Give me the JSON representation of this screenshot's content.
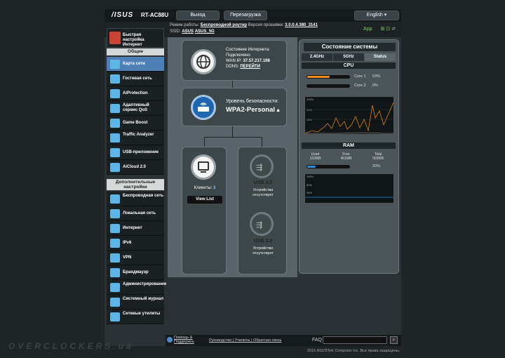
{
  "header": {
    "logo": "/ISUS",
    "model": "RT-AC88U",
    "logout": "Выход",
    "reboot": "Перезагрузка",
    "language": "English"
  },
  "info": {
    "mode_label": "Режим работы:",
    "mode_value": "Беспроводной роутер",
    "fw_label": "Версия прошивки:",
    "fw_value": "3.0.0.4.380_3141",
    "ssid_label": "SSID:",
    "ssid1": "ASUS",
    "ssid2": "ASUS_5G",
    "app": "App"
  },
  "sidebar": {
    "quick_setup": "Быстрая настройка Интернет",
    "general": "Общие",
    "items": [
      {
        "label": "Карта сети",
        "icon": "network-map-icon",
        "active": true
      },
      {
        "label": "Гостевая сеть",
        "icon": "guest-network-icon"
      },
      {
        "label": "AiProtection",
        "icon": "aiprotection-icon"
      },
      {
        "label": "Адаптивный сервис QoS",
        "icon": "qos-icon"
      },
      {
        "label": "Game Boost",
        "icon": "game-boost-icon"
      },
      {
        "label": "Traffic Analyzer",
        "icon": "traffic-analyzer-icon"
      },
      {
        "label": "USB-приложение",
        "icon": "usb-app-icon"
      },
      {
        "label": "AiCloud 2.0",
        "icon": "aicloud-icon"
      }
    ],
    "advanced": "Дополнительные настройки",
    "adv_items": [
      {
        "label": "Беспроводная сеть",
        "icon": "wireless-icon"
      },
      {
        "label": "Локальная сеть",
        "icon": "lan-icon"
      },
      {
        "label": "Интернет",
        "icon": "wan-icon"
      },
      {
        "label": "IPv6",
        "icon": "ipv6-icon"
      },
      {
        "label": "VPN",
        "icon": "vpn-icon"
      },
      {
        "label": "Брандмауэр",
        "icon": "firewall-icon"
      },
      {
        "label": "Администрирование",
        "icon": "admin-icon"
      },
      {
        "label": "Системный журнал",
        "icon": "syslog-icon"
      },
      {
        "label": "Сетевые утилиты",
        "icon": "network-tools-icon"
      }
    ]
  },
  "map": {
    "internet_status_label": "Состояние Интернета:",
    "internet_status": "Подключено",
    "wan_ip_label": "WAN IP:",
    "wan_ip": "37.57.217.198",
    "ddns_label": "DDNS:",
    "ddns_link": "ПЕРЕЙТИ",
    "security_label": "Уровень безопасности:",
    "security_value": "WPA2-Personal",
    "clients_label": "Клиенты:",
    "clients_count": "3",
    "view_list": "View List",
    "usb1_label": "USB 3.0",
    "usb1_status": "Устройство отсутствует",
    "usb2_label": "USB 2.0",
    "usb2_status": "Устройство отсутствует"
  },
  "status": {
    "title": "Состояние системы",
    "tabs": [
      "2.4GHz",
      "5GHz",
      "Status"
    ],
    "cpu_title": "CPU",
    "core1_label": "Core 1",
    "core1_value": "53%",
    "core1_pct": 53,
    "core2_label": "Core 2",
    "core2_value": "0%",
    "core2_pct": 0,
    "graph_labels": [
      "100%",
      "50%",
      "25%"
    ],
    "ram_title": "RAM",
    "used_label": "Used",
    "used_value": "102MB",
    "free_label": "Free",
    "free_value": "401MB",
    "total_label": "Total",
    "total_value": "503MB",
    "ram_pct_text": "20%",
    "ram_pct": 20,
    "cpu_color": "#f08a1c",
    "ram_color": "#2b8fe0"
  },
  "footer": {
    "help": "Помощь & Поддержка",
    "links": "Руководство | Утилиты | Обратная связь",
    "faq": "FAQ",
    "copyright": "2016 ASUSTeK Computer Inc. Все права защищены."
  },
  "watermark": "OVERCLOCKERS.ua"
}
